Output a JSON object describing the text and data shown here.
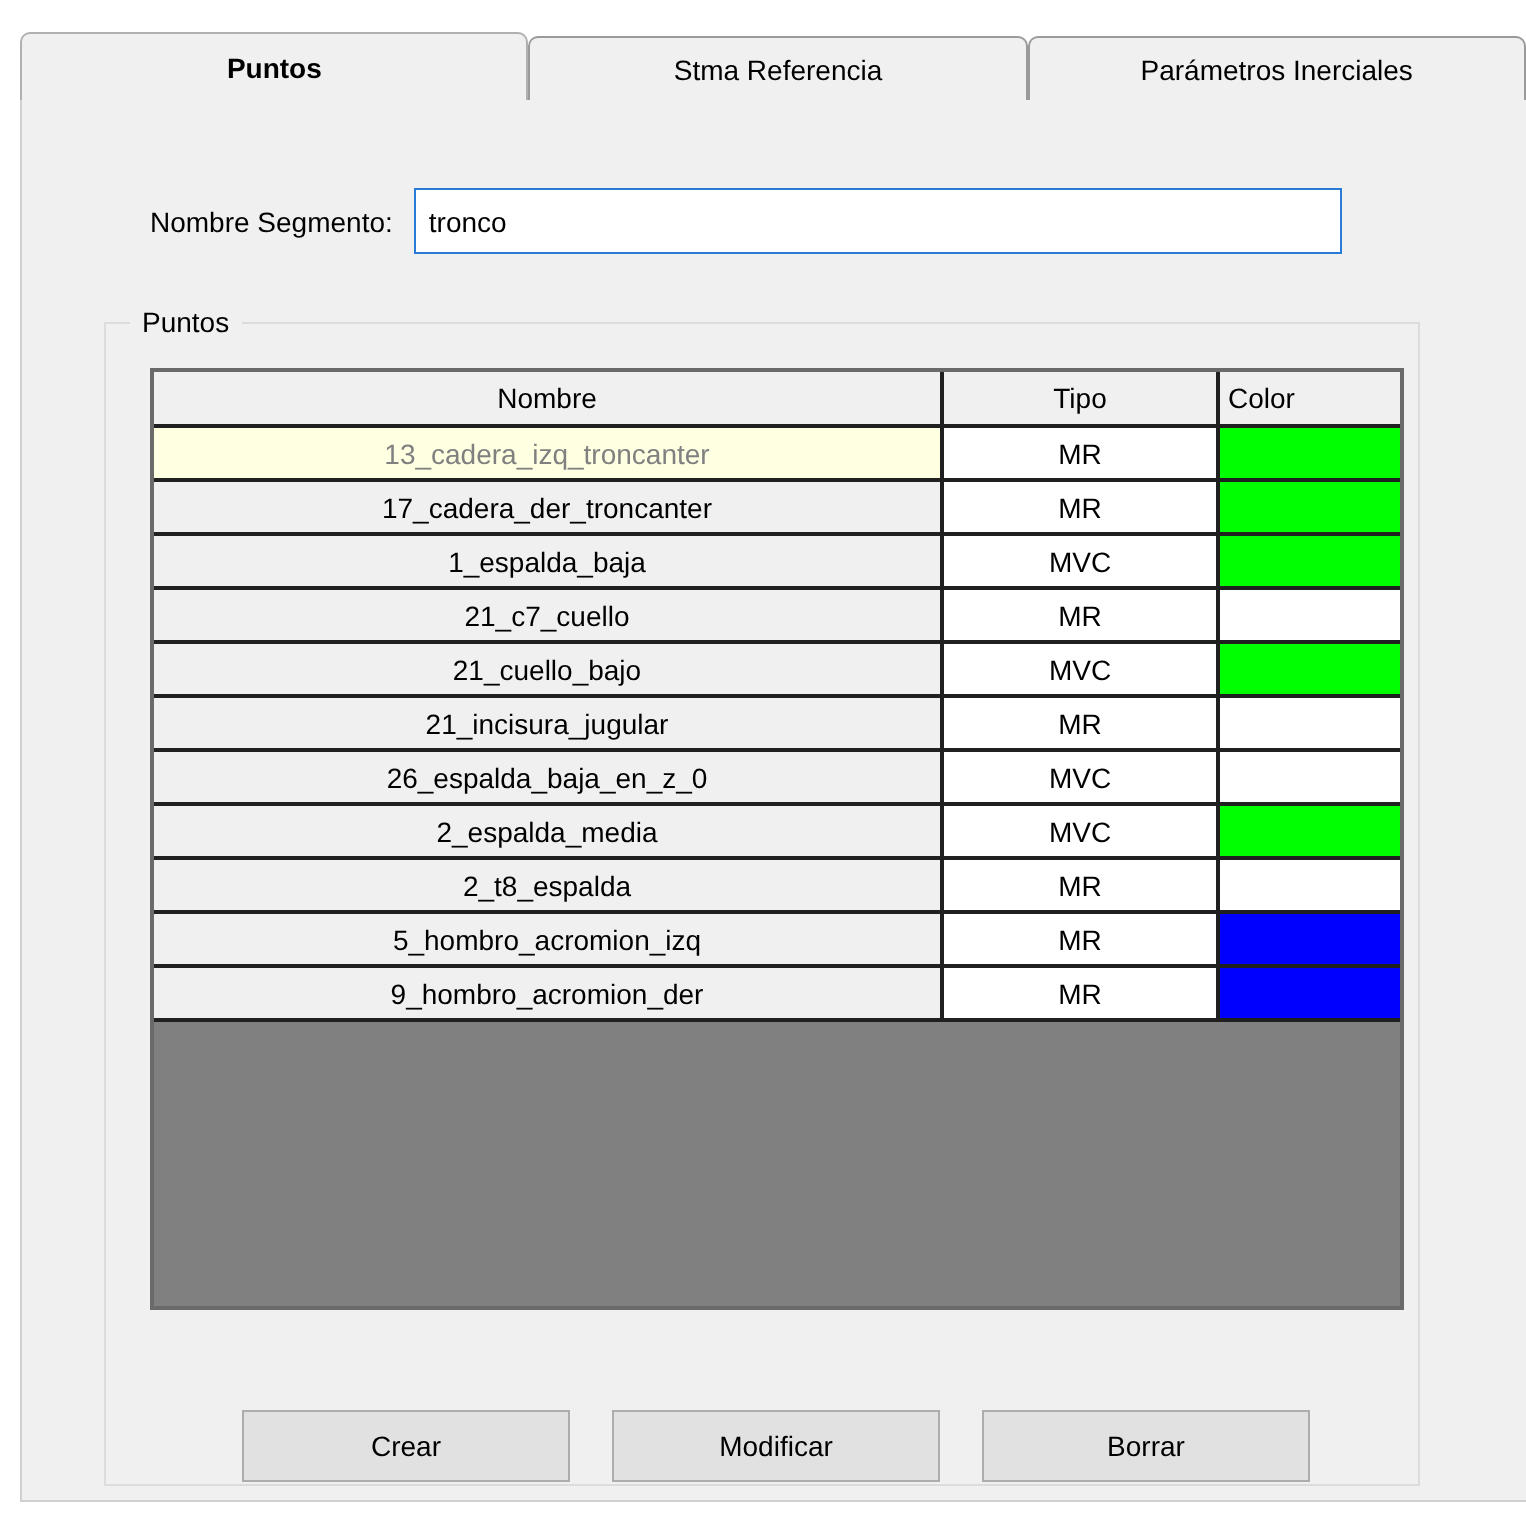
{
  "tabs": [
    {
      "label": "Puntos",
      "selected": true
    },
    {
      "label": "Stma Referencia",
      "selected": false
    },
    {
      "label": "Parámetros Inerciales",
      "selected": false
    }
  ],
  "segment_name": {
    "label": "Nombre Segmento:",
    "value": "tronco"
  },
  "group": {
    "title": "Puntos"
  },
  "table": {
    "columns": [
      "Nombre",
      "Tipo",
      "Color"
    ],
    "rows": [
      {
        "nombre": "13_cadera_izq_troncanter",
        "tipo": "MR",
        "color": "#00ff00",
        "selected": true
      },
      {
        "nombre": "17_cadera_der_troncanter",
        "tipo": "MR",
        "color": "#00ff00",
        "selected": false
      },
      {
        "nombre": "1_espalda_baja",
        "tipo": "MVC",
        "color": "#00ff00",
        "selected": false
      },
      {
        "nombre": "21_c7_cuello",
        "tipo": "MR",
        "color": "#ffffff",
        "selected": false
      },
      {
        "nombre": "21_cuello_bajo",
        "tipo": "MVC",
        "color": "#00ff00",
        "selected": false
      },
      {
        "nombre": "21_incisura_jugular",
        "tipo": "MR",
        "color": "#ffffff",
        "selected": false
      },
      {
        "nombre": "26_espalda_baja_en_z_0",
        "tipo": "MVC",
        "color": "#ffffff",
        "selected": false
      },
      {
        "nombre": "2_espalda_media",
        "tipo": "MVC",
        "color": "#00ff00",
        "selected": false
      },
      {
        "nombre": "2_t8_espalda",
        "tipo": "MR",
        "color": "#ffffff",
        "selected": false
      },
      {
        "nombre": "5_hombro_acromion_izq",
        "tipo": "MR",
        "color": "#0000ff",
        "selected": false
      },
      {
        "nombre": "9_hombro_acromion_der",
        "tipo": "MR",
        "color": "#0000ff",
        "selected": false
      }
    ]
  },
  "buttons": [
    "Crear",
    "Modificar",
    "Borrar"
  ]
}
